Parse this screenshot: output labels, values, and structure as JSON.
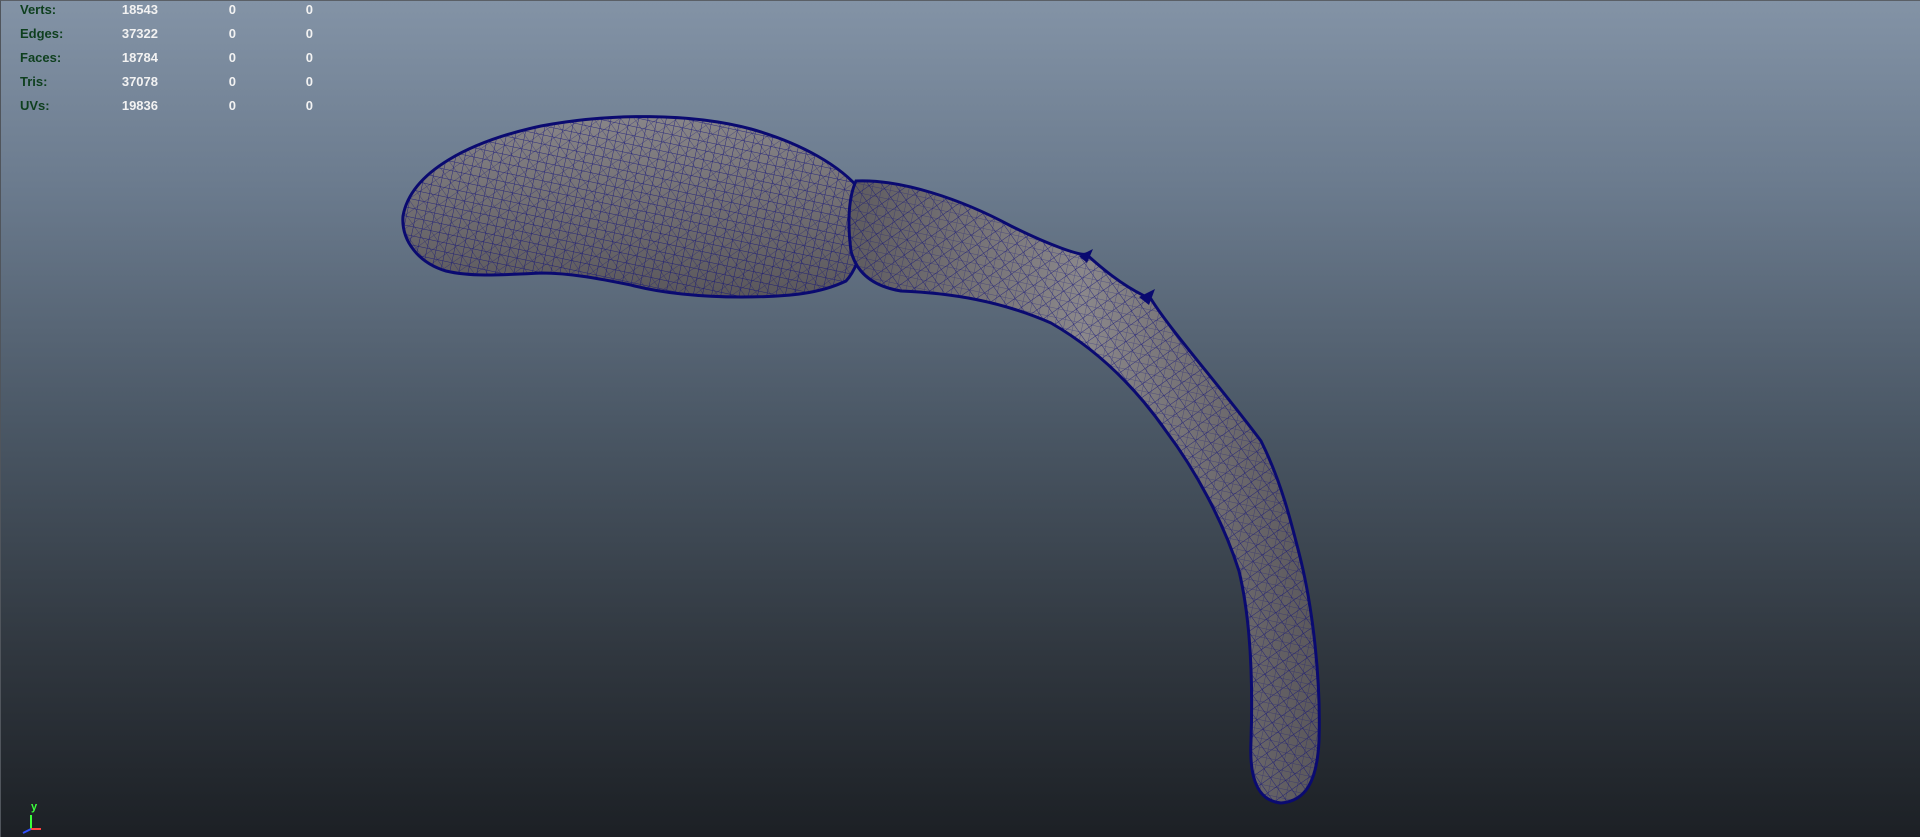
{
  "hud": {
    "rows": [
      {
        "label": "Verts:",
        "values": [
          "18543",
          "0",
          "0"
        ]
      },
      {
        "label": "Edges:",
        "values": [
          "37322",
          "0",
          "0"
        ]
      },
      {
        "label": "Faces:",
        "values": [
          "18784",
          "0",
          "0"
        ]
      },
      {
        "label": "Tris:",
        "values": [
          "37078",
          "0",
          "0"
        ]
      },
      {
        "label": "UVs:",
        "values": [
          "19836",
          "0",
          "0"
        ]
      }
    ]
  },
  "axis": {
    "y_label": "y"
  },
  "colors": {
    "hud_label": "#0e3f1e",
    "hud_value": "#f2f2f2",
    "wire": "#0c0c7a",
    "surface": "#6d6a6d",
    "axis_y": "#3cff3c",
    "axis_x": "#ff4040",
    "axis_z": "#3050ff"
  },
  "icons": [
    "axis-gizmo-icon"
  ]
}
